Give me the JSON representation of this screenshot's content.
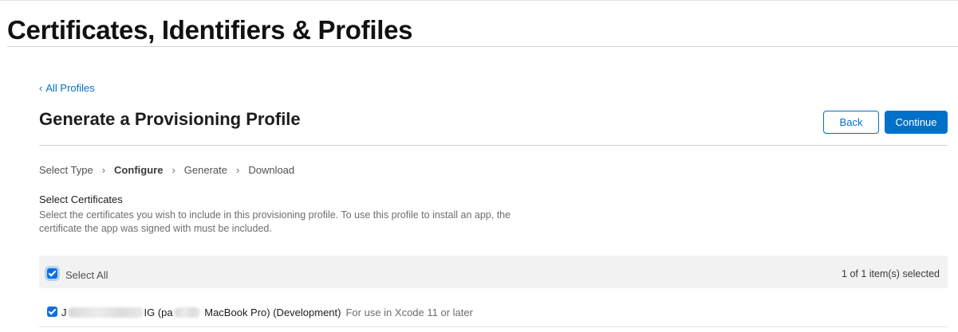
{
  "page": {
    "title": "Certificates, Identifiers & Profiles"
  },
  "nav": {
    "back_link_chevron": "‹",
    "back_link_label": "All Profiles"
  },
  "section": {
    "title": "Generate a Provisioning Profile",
    "back_button": "Back",
    "continue_button": "Continue"
  },
  "steps": [
    {
      "label": "Select Type",
      "active": false
    },
    {
      "label": "Configure",
      "active": true
    },
    {
      "label": "Generate",
      "active": false
    },
    {
      "label": "Download",
      "active": false
    }
  ],
  "step_separator": "›",
  "certificates": {
    "heading": "Select Certificates",
    "description": "Select the certificates you wish to include in this provisioning profile. To use this profile to install an app, the certificate the app was signed with must be included.",
    "select_all_label": "Select All",
    "select_all_checked": true,
    "selection_count": "1 of 1 item(s) selected",
    "items": [
      {
        "checked": true,
        "name_prefix": "J",
        "name_middle": "IG (pa",
        "name_suffix": "MacBook Pro) (Development)",
        "meta": "For use in Xcode 11 or later"
      }
    ]
  },
  "colors": {
    "accent": "#0070c9",
    "checkbox": "#0a6fe3",
    "header_bg": "#f2f2f2"
  }
}
